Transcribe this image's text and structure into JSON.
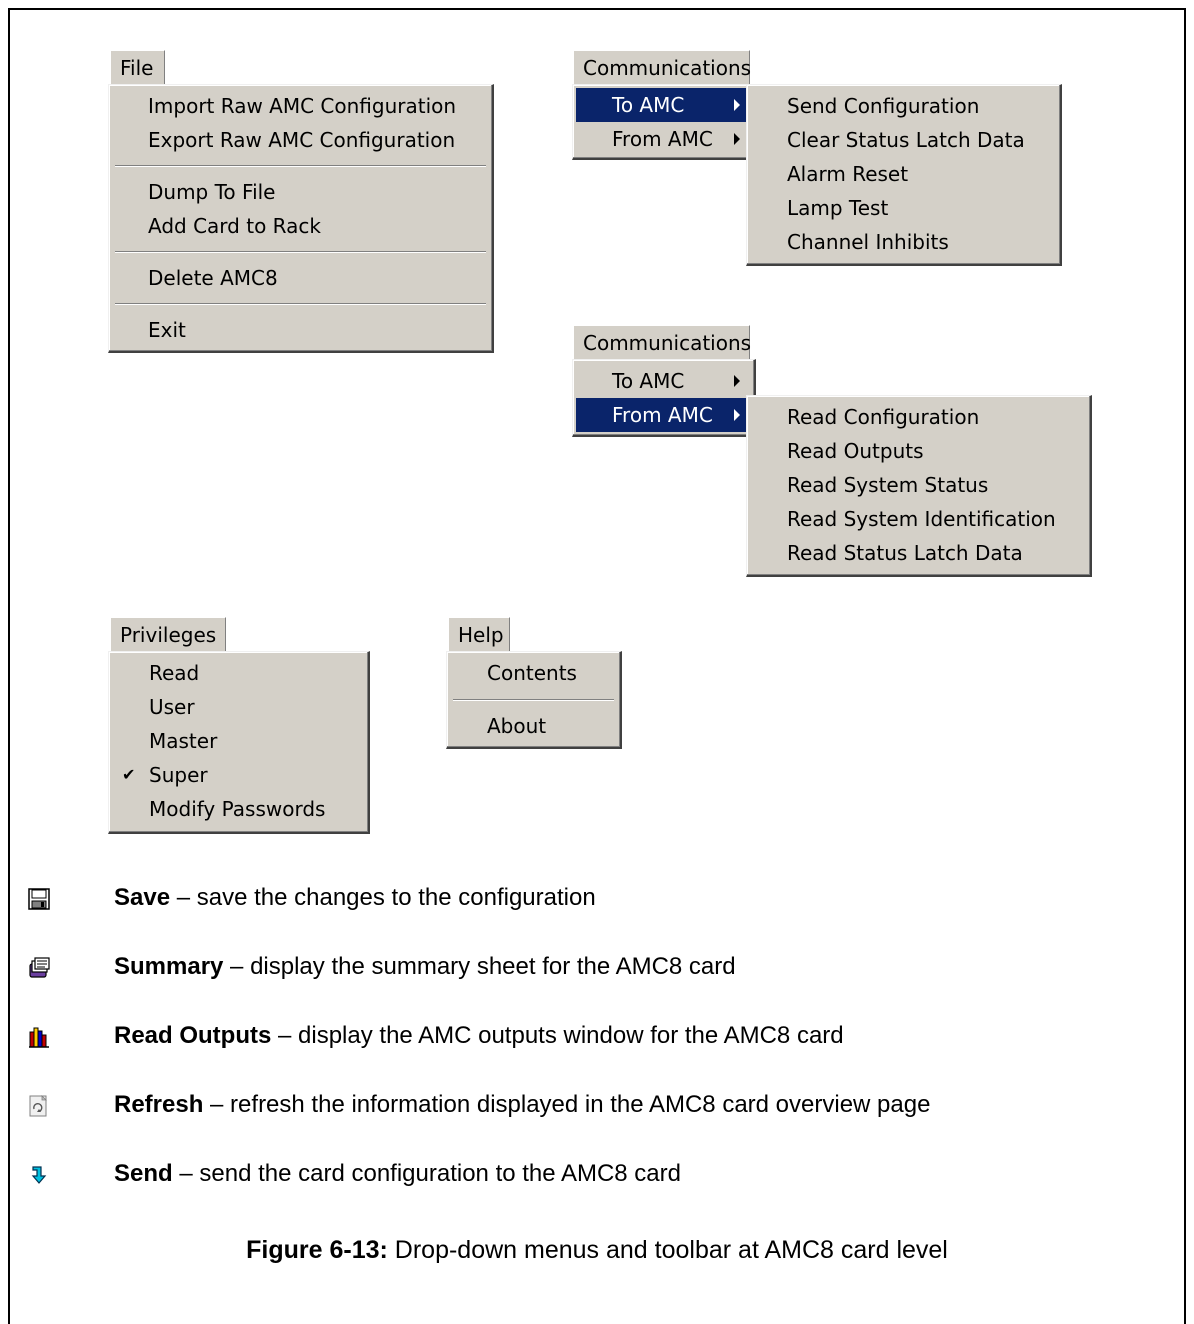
{
  "file_menu": {
    "title": "File",
    "items": [
      "Import Raw AMC Configuration",
      "Export Raw AMC Configuration",
      "Dump To File",
      "Add Card to Rack",
      "Delete AMC8",
      "Exit"
    ]
  },
  "comm_menu_to": {
    "title": "Communications",
    "items": [
      "To AMC",
      "From AMC"
    ],
    "submenu": [
      "Send Configuration",
      "Clear Status Latch Data",
      "Alarm Reset",
      "Lamp Test",
      "Channel Inhibits"
    ]
  },
  "comm_menu_from": {
    "title": "Communications",
    "items": [
      "To AMC",
      "From AMC"
    ],
    "submenu": [
      "Read Configuration",
      "Read Outputs",
      "Read System Status",
      "Read System Identification",
      "Read Status Latch Data"
    ]
  },
  "privileges_menu": {
    "title": "Privileges",
    "items": [
      "Read",
      "User",
      "Master",
      "Super",
      "Modify Passwords"
    ],
    "checked": "Super"
  },
  "help_menu": {
    "title": "Help",
    "items": [
      "Contents",
      "About"
    ]
  },
  "toolbar": [
    {
      "icon": "floppy-disk-icon",
      "name": "Save",
      "desc": " – save the changes to the configuration"
    },
    {
      "icon": "summary-sheet-icon",
      "name": "Summary",
      "desc": " – display the summary sheet for the AMC8 card"
    },
    {
      "icon": "bar-outputs-icon",
      "name": "Read Outputs",
      "desc": " – display the AMC outputs window for the AMC8 card"
    },
    {
      "icon": "refresh-icon",
      "name": "Refresh",
      "desc": " – refresh the information displayed in the AMC8 card overview page"
    },
    {
      "icon": "send-arrow-icon",
      "name": "Send",
      "desc": " – send the card configuration to the AMC8 card"
    }
  ],
  "caption": {
    "label": "Figure 6-13:",
    "text": " Drop-down menus and toolbar at AMC8 card level"
  },
  "colors": {
    "menu_bg": "#d4d0c8",
    "highlight": "#0a246a"
  }
}
